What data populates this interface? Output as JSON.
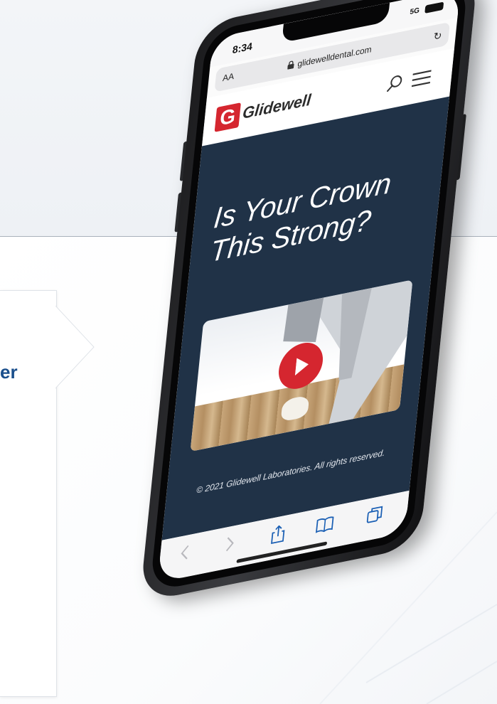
{
  "callout": {
    "text": "er"
  },
  "status_bar": {
    "time": "8:34",
    "network": "5G"
  },
  "address_bar": {
    "text_size_label": "AA",
    "url": "glidewelldental.com"
  },
  "site_header": {
    "logo_letter": "G",
    "logo_text": "Glidewell"
  },
  "hero": {
    "headline_line1": "Is Your Crown",
    "headline_line2": "This Strong?",
    "copyright": "© 2021 Glidewell Laboratories. All rights reserved."
  },
  "colors": {
    "brand_red": "#d5262f",
    "hero_navy": "#203247",
    "callout_blue": "#1a4f8c"
  }
}
